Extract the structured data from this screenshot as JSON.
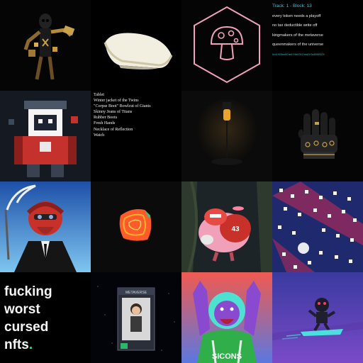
{
  "gallery": {
    "track_tile": {
      "header": "Track: 1 - Block: 13",
      "lines": [
        "every token needs a playoff",
        "no tax deductible write off",
        "kingmakers of the metaverse",
        "queenmakers of the universe"
      ],
      "hash": "0x41f03bed97de5ff6a33417eb03f5a38989529"
    },
    "loot_tile": {
      "items": [
        "Tablet",
        "Winter jacket of the Twins",
        "\"Corpse Boot\" Bowlcut of Giants",
        "Skinny Jeans of Titans",
        "Rubber Boots",
        "Fresh Hands",
        "Necklace of Reflection",
        "Watch"
      ]
    },
    "cursed_tile": {
      "lines": [
        "fucking",
        "worst",
        "cursed",
        "nfts"
      ],
      "punctuation": "."
    },
    "jersey_tile": {
      "jersey_number": "43"
    },
    "lion_tile": {
      "shirt_text": "SICONS"
    },
    "doll_tile": {
      "box_label": "METAVERSE"
    }
  },
  "colors": {
    "accent_cyan": "#3fc7d9",
    "cursed_dot": "#2ad8a0",
    "mushroom_outline": "#f0a0b8"
  },
  "icons": {
    "mushroom": "mushroom-icon",
    "hexagon": "hexagon-icon"
  }
}
